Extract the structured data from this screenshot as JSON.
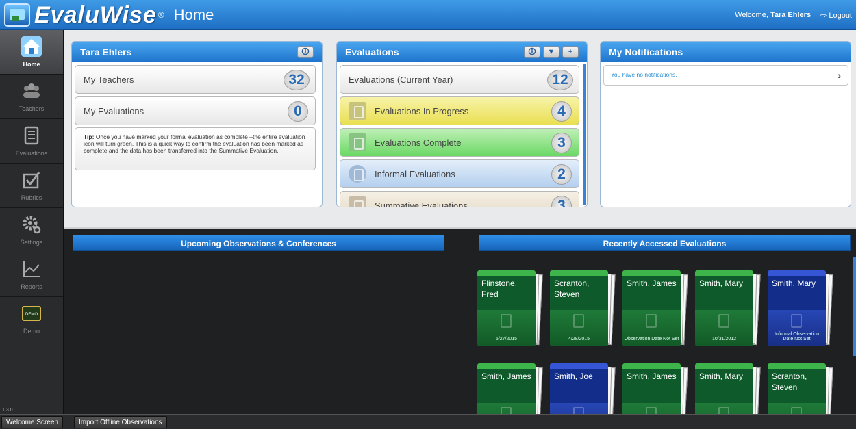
{
  "header": {
    "logo_text": "EvaluWise",
    "logo_reg": "®",
    "title": "Home",
    "welcome_prefix": "Welcome,",
    "user_name": "Tara Ehlers",
    "logout_label": "Logout"
  },
  "sidebar": {
    "items": [
      {
        "label": "Home",
        "icon": "home-icon"
      },
      {
        "label": "Teachers",
        "icon": "teachers-icon"
      },
      {
        "label": "Evaluations",
        "icon": "evaluations-icon"
      },
      {
        "label": "Rubrics",
        "icon": "rubrics-icon"
      },
      {
        "label": "Settings",
        "icon": "settings-icon"
      },
      {
        "label": "Reports",
        "icon": "reports-icon"
      },
      {
        "label": "Demo",
        "icon": "demo-icon"
      }
    ],
    "demo_badge": "DEMO",
    "version": "1.3.0"
  },
  "profile_panel": {
    "title": "Tara Ehlers",
    "rows": [
      {
        "label": "My Teachers",
        "count": "32"
      },
      {
        "label": "My Evaluations",
        "count": "0"
      }
    ],
    "tip_bold": "Tip:",
    "tip_text": "Once you have marked your formal evaluation as complete –the entire evaluation icon will turn green. This is a quick way to confirm the evaluation has been marked as complete and the data has been transferred into the Summative Evaluation."
  },
  "evaluations_panel": {
    "title": "Evaluations",
    "rows": [
      {
        "label": "Evaluations (Current Year)",
        "count": "12",
        "color": "#f1f1f1"
      },
      {
        "label": "Evaluations In Progress",
        "count": "4",
        "color": "#f1e96a"
      },
      {
        "label": "Evaluations Complete",
        "count": "3",
        "color": "#7fe07a"
      },
      {
        "label": "Informal Evaluations",
        "count": "2",
        "color": "#bcd6f2"
      },
      {
        "label": "Summative Evaluations",
        "count": "3",
        "color": "#e8dfcf"
      }
    ]
  },
  "notifications_panel": {
    "title": "My Notifications",
    "message": "You have no notifications."
  },
  "upcoming_bar": "Upcoming Observations & Conferences",
  "recent_bar": "Recently Accessed Evaluations",
  "recent_cards": [
    {
      "name": "Flinstone, Fred",
      "date": "5/27/2015",
      "color": "green"
    },
    {
      "name": "Scranton, Steven",
      "date": "4/28/2015",
      "color": "green"
    },
    {
      "name": "Smith, James",
      "date": "Observation Date Not Set",
      "color": "green"
    },
    {
      "name": "Smith, Mary",
      "date": "10/31/2012",
      "color": "green"
    },
    {
      "name": "Smith, Mary",
      "date": "Informal Observation Date Not Set",
      "color": "blue"
    },
    {
      "name": "Smith, James",
      "date": "",
      "color": "green"
    },
    {
      "name": "Smith, Joe",
      "date": "",
      "color": "blue"
    },
    {
      "name": "Smith, James",
      "date": "",
      "color": "green"
    },
    {
      "name": "Smith, Mary",
      "date": "",
      "color": "green"
    },
    {
      "name": "Scranton, Steven",
      "date": "",
      "color": "green"
    }
  ],
  "footer": {
    "welcome_button": "Welcome Screen",
    "import_button": "Import Offline Observations"
  }
}
